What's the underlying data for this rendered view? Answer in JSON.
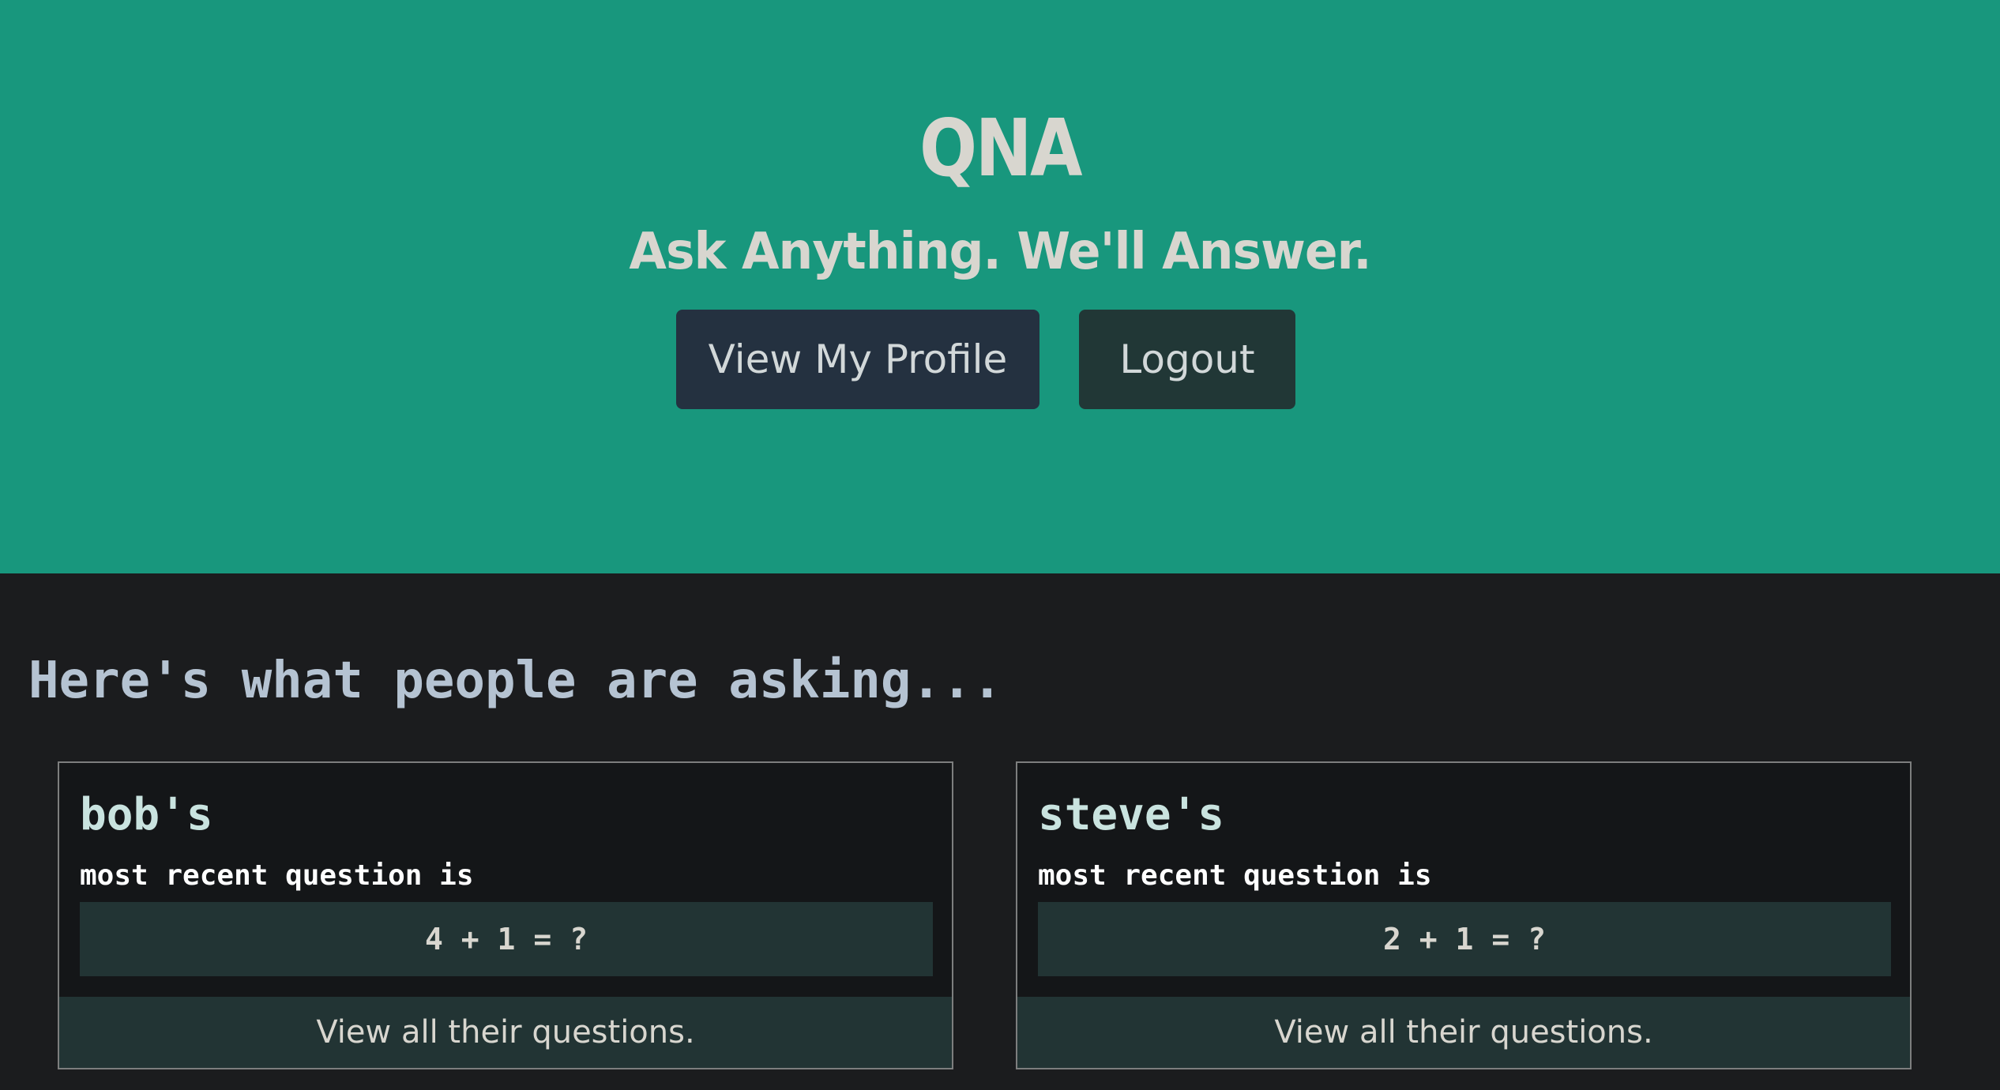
{
  "hero": {
    "title": "QNA",
    "subtitle": "Ask Anything. We'll Answer.",
    "buttons": {
      "profile_label": "View My Profile",
      "logout_label": "Logout"
    }
  },
  "main": {
    "heading": "Here's what people are asking...",
    "cards": [
      {
        "user": "bob's",
        "caption": "most recent question is",
        "question": "4 + 1 = ?",
        "link_label": "View all their questions."
      },
      {
        "user": "steve's",
        "caption": "most recent question is",
        "question": "2 + 1 = ?",
        "link_label": "View all their questions."
      }
    ]
  },
  "colors": {
    "hero_background": "#18977d",
    "page_background": "#1b1c1e",
    "profile_button": "#243140",
    "logout_button": "#213736",
    "card_background": "#141618",
    "question_background": "#223434",
    "heading_text": "#b5c3d2"
  }
}
